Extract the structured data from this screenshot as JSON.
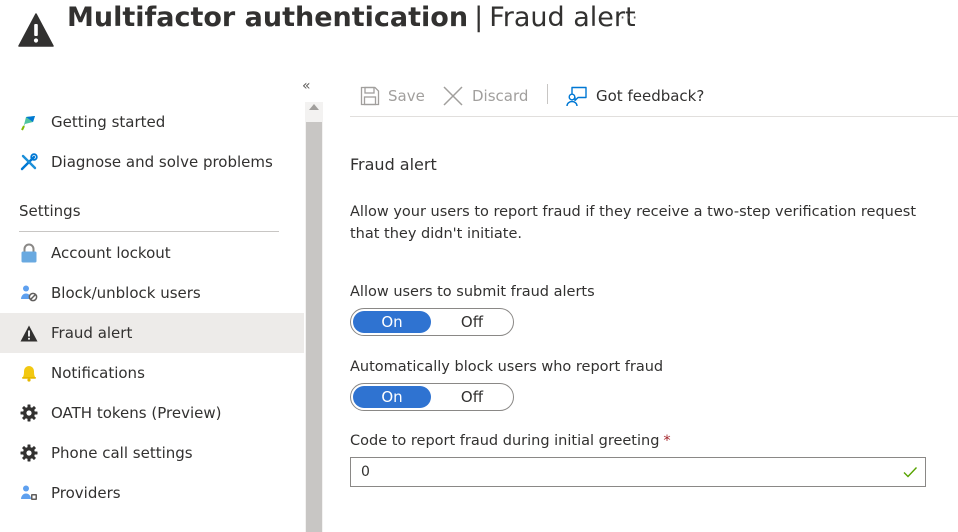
{
  "header": {
    "title": "Multifactor authentication",
    "separator": "|",
    "subtitle": "Fraud alert",
    "more": "···",
    "icon": "warning-icon"
  },
  "sidebar": {
    "collapse": "«",
    "items": [
      {
        "label": "Getting started",
        "icon": "quickstart-icon"
      },
      {
        "label": "Diagnose and solve problems",
        "icon": "wrench-icon"
      },
      {
        "label": "Account lockout",
        "icon": "lock-icon"
      },
      {
        "label": "Block/unblock users",
        "icon": "block-user-icon"
      },
      {
        "label": "Fraud alert",
        "icon": "warning-icon",
        "selected": true
      },
      {
        "label": "Notifications",
        "icon": "bell-icon"
      },
      {
        "label": "OATH tokens (Preview)",
        "icon": "gear-icon"
      },
      {
        "label": "Phone call settings",
        "icon": "gear-icon"
      },
      {
        "label": "Providers",
        "icon": "provider-icon"
      }
    ],
    "section_header": "Settings"
  },
  "toolbar": {
    "save_label": "Save",
    "discard_label": "Discard",
    "feedback_label": "Got feedback?"
  },
  "content": {
    "title": "Fraud alert",
    "description": "Allow your users to report fraud if they receive a two-step verification request that they didn't initiate.",
    "allow_submit": {
      "label": "Allow users to submit fraud alerts",
      "on_label": "On",
      "off_label": "Off",
      "value": "On"
    },
    "auto_block": {
      "label": "Automatically block users who report fraud",
      "on_label": "On",
      "off_label": "Off",
      "value": "On"
    },
    "code": {
      "label": "Code to report fraud during initial greeting",
      "required_marker": "*",
      "value": "0"
    }
  },
  "colors": {
    "accent": "#2f73d1",
    "selected_bg": "#edebe9",
    "warning_icon": "#323130",
    "bell": "#f2c811",
    "valid_check": "#57a300",
    "required": "#a4262c"
  }
}
